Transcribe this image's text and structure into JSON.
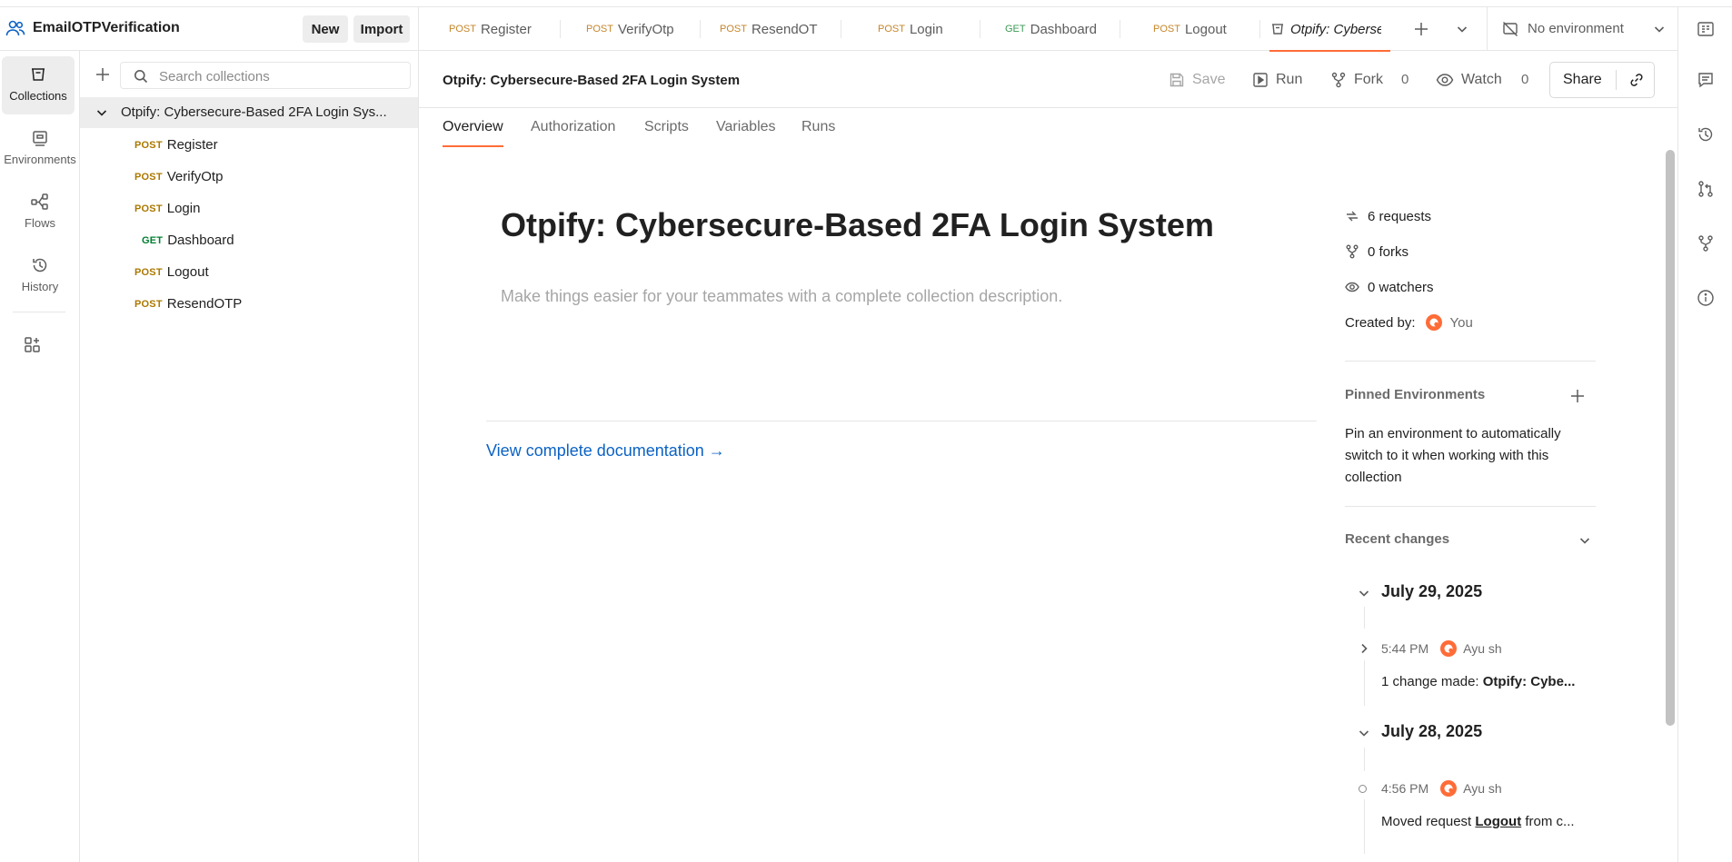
{
  "workspace": {
    "name": "EmailOTPVerification",
    "new_label": "New",
    "import_label": "Import"
  },
  "rail": {
    "items": [
      {
        "label": "Collections",
        "icon": "collections-icon"
      },
      {
        "label": "Environments",
        "icon": "environments-icon"
      },
      {
        "label": "Flows",
        "icon": "flows-icon"
      },
      {
        "label": "History",
        "icon": "history-icon"
      }
    ],
    "add_icon": "configure-workbench-icon"
  },
  "sidebar": {
    "search_placeholder": "Search collections",
    "collection_name": "Otpify: Cybersecure-Based 2FA Login Sys...",
    "requests": [
      {
        "method": "POST",
        "name": "Register"
      },
      {
        "method": "POST",
        "name": "VerifyOtp"
      },
      {
        "method": "POST",
        "name": "Login"
      },
      {
        "method": "GET",
        "name": "Dashboard"
      },
      {
        "method": "POST",
        "name": "Logout"
      },
      {
        "method": "POST",
        "name": "ResendOTP"
      }
    ]
  },
  "tabs": [
    {
      "method": "POST",
      "name": "Register"
    },
    {
      "method": "POST",
      "name": "VerifyOtp"
    },
    {
      "method": "POST",
      "name": "ResendOTF"
    },
    {
      "method": "POST",
      "name": "Login"
    },
    {
      "method": "GET",
      "name": "Dashboard"
    },
    {
      "method": "POST",
      "name": "Logout"
    },
    {
      "method": "",
      "name": "Otpify: Cyberse"
    }
  ],
  "environment": {
    "selected": "No environment"
  },
  "titlebar": {
    "title": "Otpify: Cybersecure-Based 2FA Login System",
    "save_label": "Save",
    "run_label": "Run",
    "fork_label": "Fork",
    "fork_count": "0",
    "watch_label": "Watch",
    "watch_count": "0",
    "share_label": "Share"
  },
  "subtabs": [
    "Overview",
    "Authorization",
    "Scripts",
    "Variables",
    "Runs"
  ],
  "overview": {
    "title": "Otpify: Cybersecure-Based 2FA Login System",
    "description_placeholder": "Make things easier for your teammates with a complete collection description.",
    "doc_link": "View complete documentation →"
  },
  "info": {
    "requests": "6 requests",
    "forks": "0 forks",
    "watchers": "0 watchers",
    "created_by_label": "Created by:",
    "created_by_value": "You",
    "pinned_title": "Pinned Environments",
    "pinned_desc": "Pin an environment to automatically switch to it when working with this collection",
    "recent_title": "Recent changes",
    "changes": [
      {
        "date": "July 29, 2025",
        "time": "5:44 PM",
        "user": "Ayu sh",
        "desc_prefix": "1",
        "desc_mid": " change made: ",
        "desc_bold": "Otpify: Cybe..."
      },
      {
        "date": "July 28, 2025",
        "time": "4:56 PM",
        "user": "Ayu sh",
        "desc_prefix": "Moved request ",
        "desc_bold": "Logout",
        "desc_suffix": " from c..."
      }
    ]
  },
  "colors": {
    "accent": "#ff6c37",
    "post": "#ab7800",
    "get": "#007f31",
    "link": "#0b62c4"
  }
}
